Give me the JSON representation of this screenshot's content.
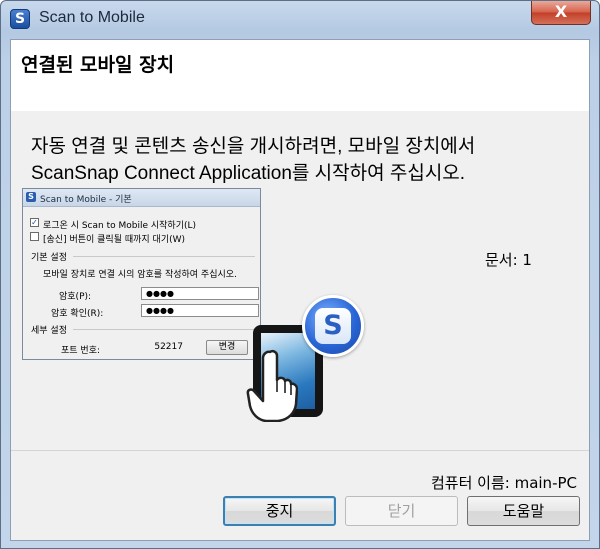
{
  "window": {
    "title": "Scan to Mobile",
    "app_icon_glyph": "S",
    "close_glyph": "X"
  },
  "header": {
    "title": "연결된 모바일 장치"
  },
  "main": {
    "instruction_line1": "자동 연결 및 콘텐츠 송신을 개시하려면, 모바일 장치에서",
    "instruction_line2": "ScanSnap Connect Application를 시작하여 주십시오.",
    "document_count": "문서: 1"
  },
  "settings_screenshot": {
    "title": "Scan to Mobile - 기본",
    "checkbox_login": "로그온 시 Scan to Mobile 시작하기(L)",
    "checkbox_login_checked": true,
    "checkbox_wait": "[송신] 버튼이 클릭될 때까지 대기(W)",
    "checkbox_wait_checked": false,
    "basic_section": "기본 설정",
    "basic_description": "모바일 장치로 연결 시의 암호를 작성하여 주십시오.",
    "password_label": "암호(P):",
    "password_value": "●●●●",
    "password_confirm_label": "암호 확인(R):",
    "password_confirm_value": "●●●●",
    "detail_section": "세부 설정",
    "port_label": "포트 번호:",
    "port_value": "52217",
    "change_button": "변경"
  },
  "illustration": {
    "badge_glyph": "S",
    "icons": [
      "tablet-icon",
      "hand-icon",
      "scansnap-badge-icon"
    ]
  },
  "footer": {
    "computer_name": "컴퓨터 이름: main-PC",
    "stop_button": "중지",
    "close_button": "닫기",
    "help_button": "도움말",
    "close_button_enabled": false
  },
  "colors": {
    "frame": "#bcd0e7",
    "client_bg": "#f0f0f0",
    "default_button_border": "#3c7fb1",
    "close_button_red": "#c33f28"
  }
}
